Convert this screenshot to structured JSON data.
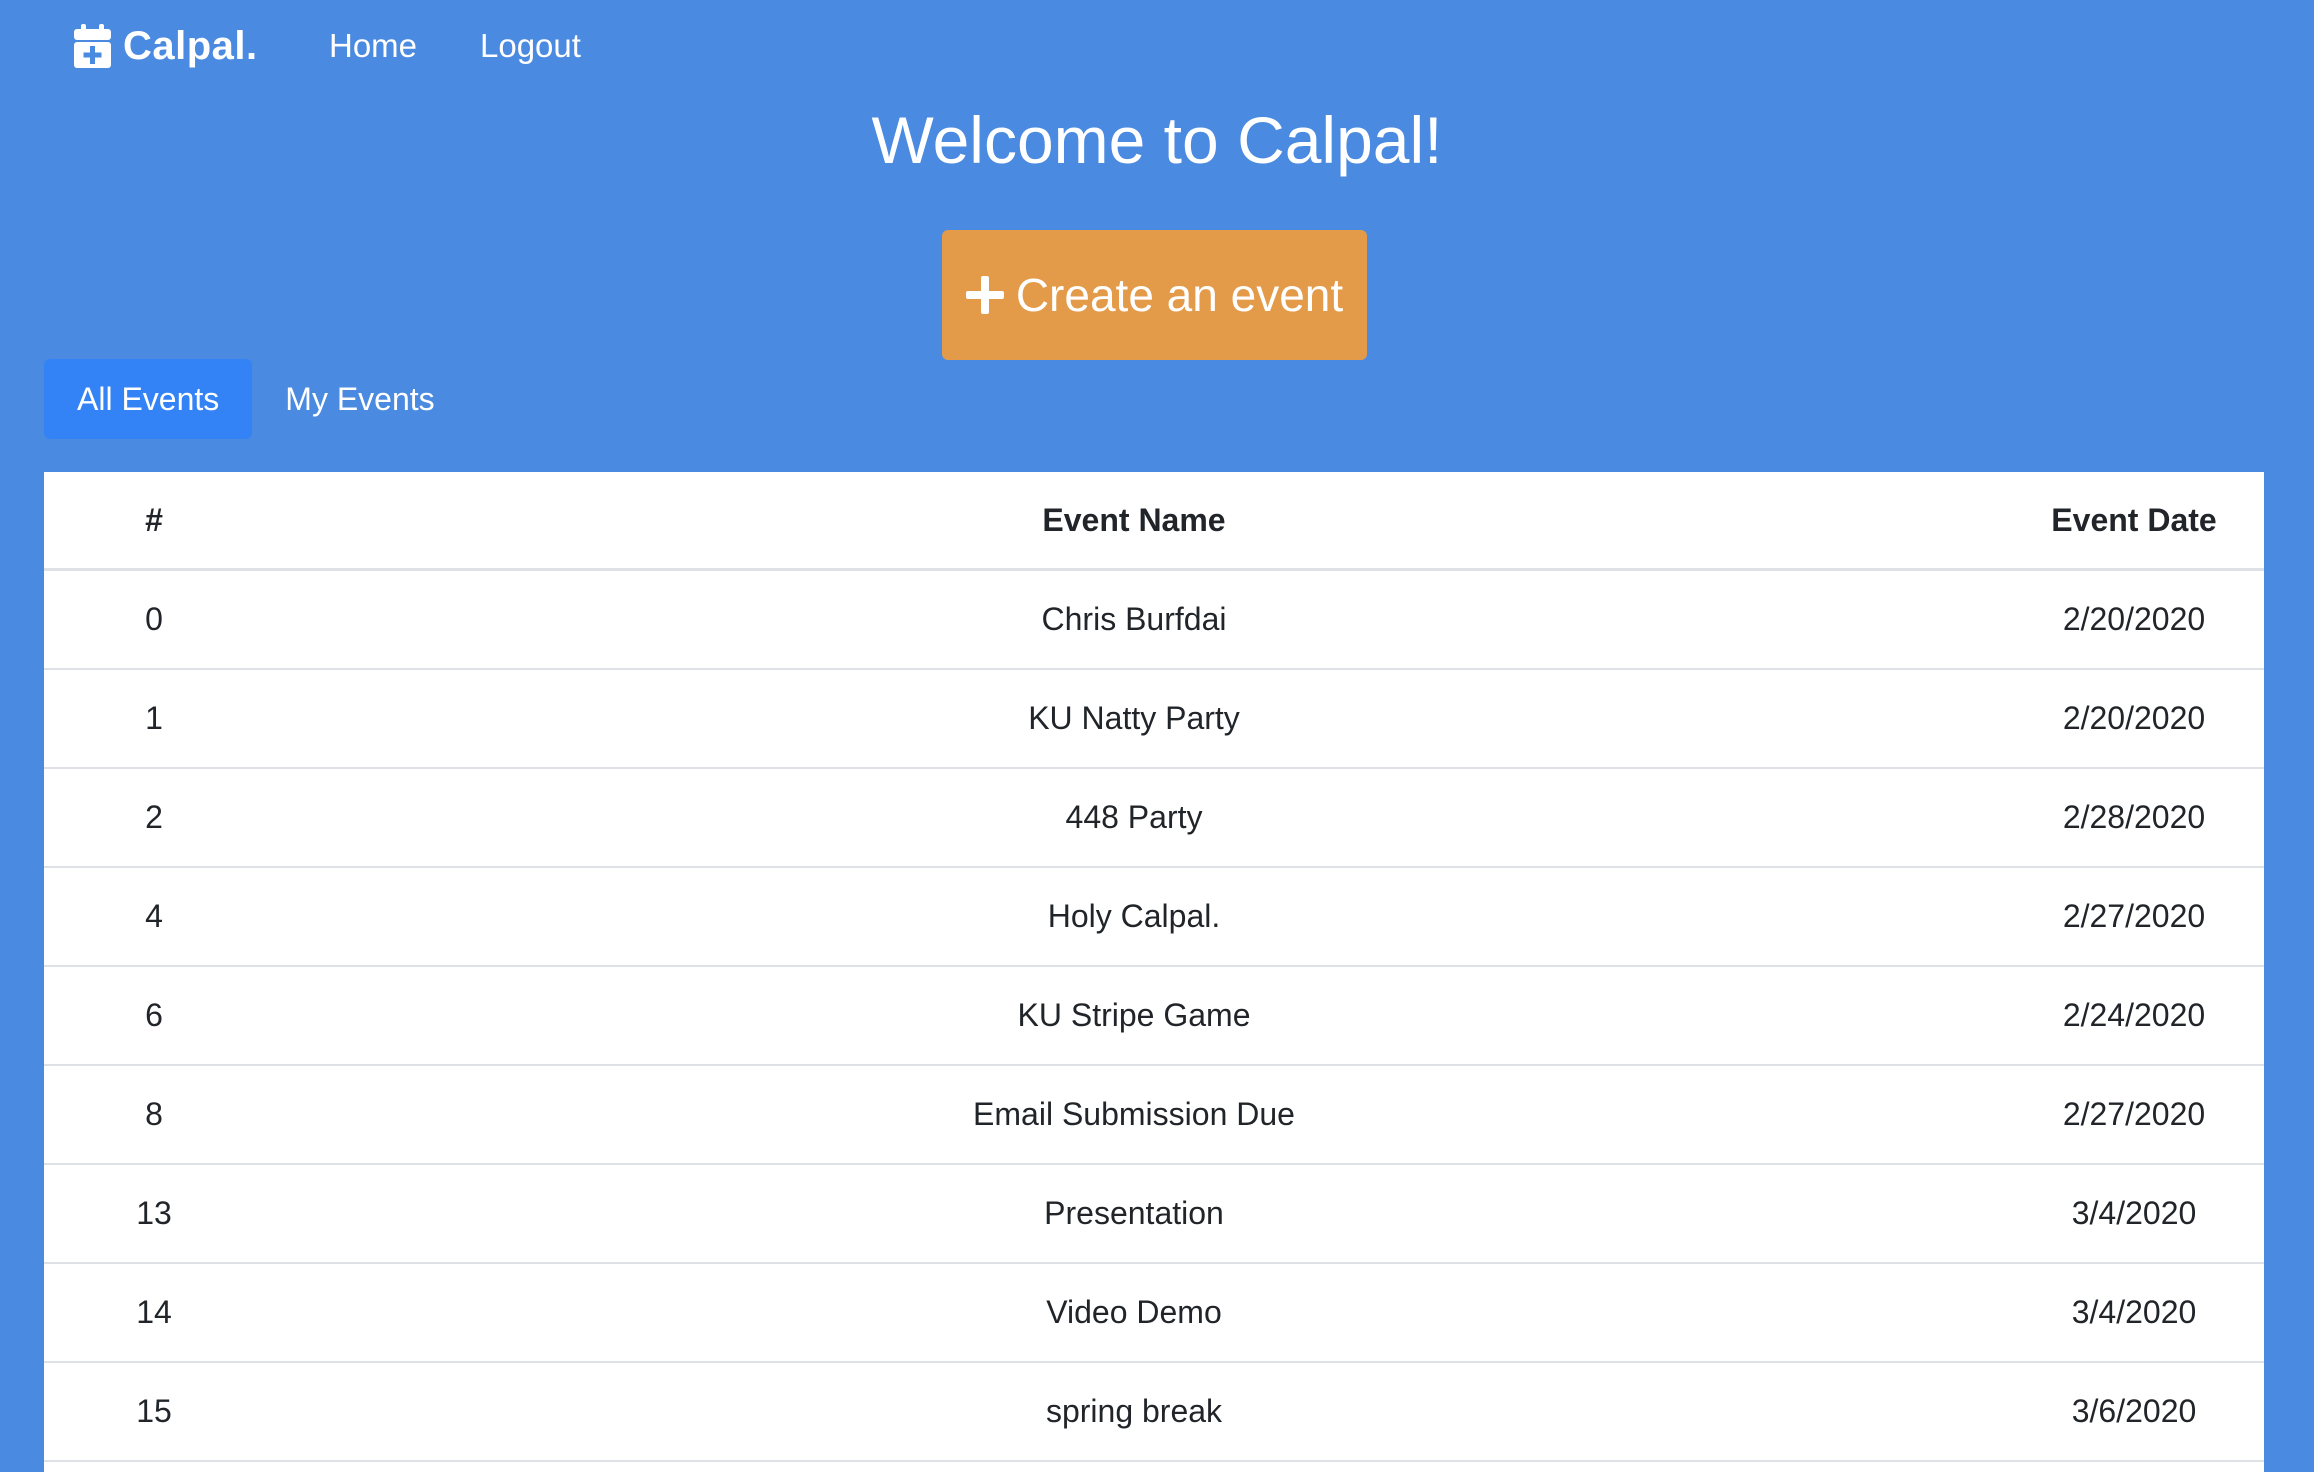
{
  "nav": {
    "brand": "Calpal.",
    "brand_icon": "calendar-plus-icon",
    "links": [
      {
        "label": "Home"
      },
      {
        "label": "Logout"
      }
    ]
  },
  "header": {
    "title": "Welcome to Calpal!"
  },
  "create_button": {
    "label": "Create an event",
    "icon": "plus-icon",
    "color": "#e39a49"
  },
  "tabs": [
    {
      "label": "All Events",
      "active": true
    },
    {
      "label": "My Events",
      "active": false
    }
  ],
  "table": {
    "columns": [
      "#",
      "Event Name",
      "Event Date"
    ],
    "rows": [
      {
        "id": "0",
        "name": "Chris Burfdai",
        "date": "2/20/2020"
      },
      {
        "id": "1",
        "name": "KU Natty Party",
        "date": "2/20/2020"
      },
      {
        "id": "2",
        "name": "448 Party",
        "date": "2/28/2020"
      },
      {
        "id": "4",
        "name": "Holy Calpal.",
        "date": "2/27/2020"
      },
      {
        "id": "6",
        "name": "KU Stripe Game",
        "date": "2/24/2020"
      },
      {
        "id": "8",
        "name": "Email Submission Due",
        "date": "2/27/2020"
      },
      {
        "id": "13",
        "name": "Presentation",
        "date": "3/4/2020"
      },
      {
        "id": "14",
        "name": "Video Demo",
        "date": "3/4/2020"
      },
      {
        "id": "15",
        "name": "spring break",
        "date": "3/6/2020"
      }
    ]
  },
  "colors": {
    "background": "#4a8ae0",
    "active_tab": "#3483f6",
    "accent": "#e39a49"
  }
}
